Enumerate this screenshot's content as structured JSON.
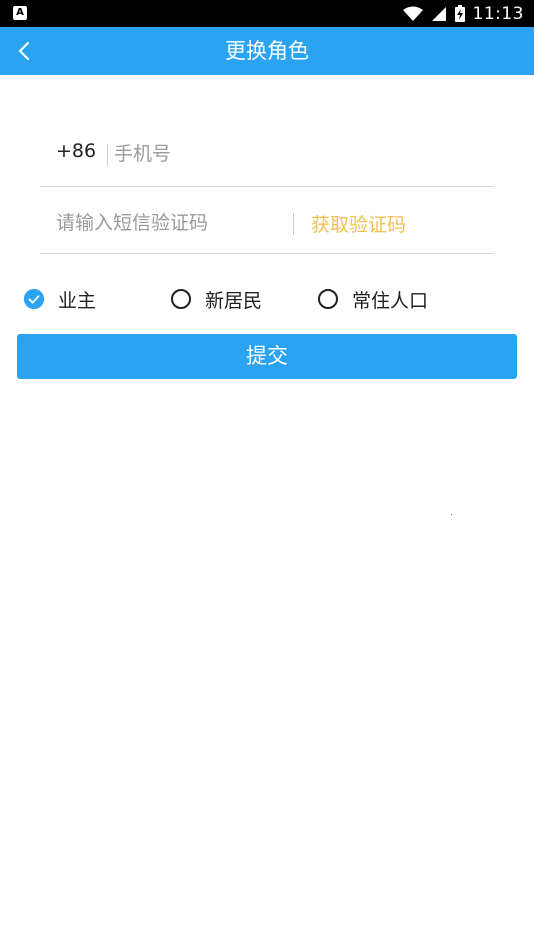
{
  "status_bar": {
    "app_icon_letter": "A",
    "time": "11:13",
    "icons": [
      "wifi-icon",
      "signal-icon",
      "battery-charging-icon"
    ]
  },
  "header": {
    "title": "更换角色",
    "back_icon": "chevron-left-icon"
  },
  "form": {
    "country_code": "+86",
    "phone_value": "",
    "phone_placeholder": "手机号",
    "code_value": "",
    "code_placeholder": "请输入短信验证码",
    "get_code_label": "获取验证码"
  },
  "roles": [
    {
      "label": "业主",
      "checked": true
    },
    {
      "label": "新居民",
      "checked": false
    },
    {
      "label": "常住人口",
      "checked": false
    }
  ],
  "submit_label": "提交",
  "colors": {
    "primary": "#2aa3f3",
    "accent": "#f1c152",
    "status_bar": "#000000"
  }
}
